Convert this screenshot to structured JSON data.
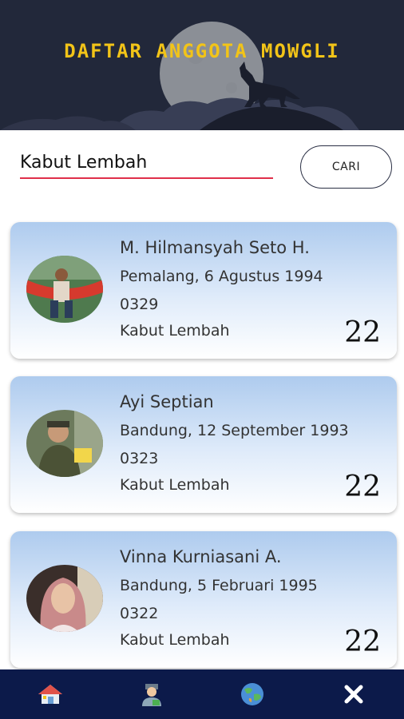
{
  "header": {
    "title": "DAFTAR ANGGOTA MOWGLI"
  },
  "search": {
    "value": "Kabut Lembah",
    "button_label": "CARI"
  },
  "members": [
    {
      "name": "M. Hilmansyah Seto H.",
      "birth": "Pemalang, 6 Agustus 1994",
      "member_id": "0329",
      "group": "Kabut Lembah",
      "number": "22"
    },
    {
      "name": "Ayi Septian",
      "birth": "Bandung, 12 September 1993",
      "member_id": "0323",
      "group": "Kabut Lembah",
      "number": "22"
    },
    {
      "name": "Vinna Kurniasani A.",
      "birth": "Bandung, 5 Februari 1995",
      "member_id": "0322",
      "group": "Kabut Lembah",
      "number": "22"
    }
  ],
  "nav": {
    "items": [
      {
        "icon": "home-icon"
      },
      {
        "icon": "person-icon"
      },
      {
        "icon": "globe-icon"
      },
      {
        "icon": "close-icon"
      }
    ]
  },
  "colors": {
    "header_bg": "#22283a",
    "title": "#f2c418",
    "nav_bg": "#0c1a4a",
    "input_underline": "#e0304a"
  }
}
